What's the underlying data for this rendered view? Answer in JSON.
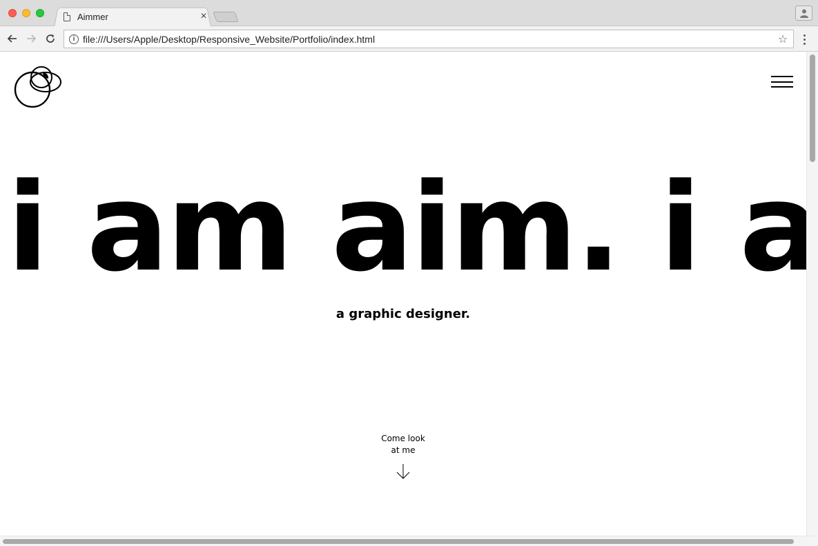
{
  "browser": {
    "tab_title": "Aimmer",
    "tab_close": "×",
    "url": "file:///Users/Apple/Desktop/Responsive_Website/Portfolio/index.html",
    "info_glyph": "i",
    "bookmark_glyph": "☆"
  },
  "page": {
    "hero_text": "i am aim. i am",
    "subtitle": "a graphic designer.",
    "cta": {
      "line1": "Come look",
      "line2": "at me"
    }
  },
  "colors": {
    "text": "#000000",
    "background": "#ffffff",
    "chrome": "#f2f2f2"
  },
  "icons": {
    "logo": "overlapping-circles-logo",
    "menu": "hamburger-menu-icon",
    "scroll_hint": "arrow-down-icon"
  }
}
